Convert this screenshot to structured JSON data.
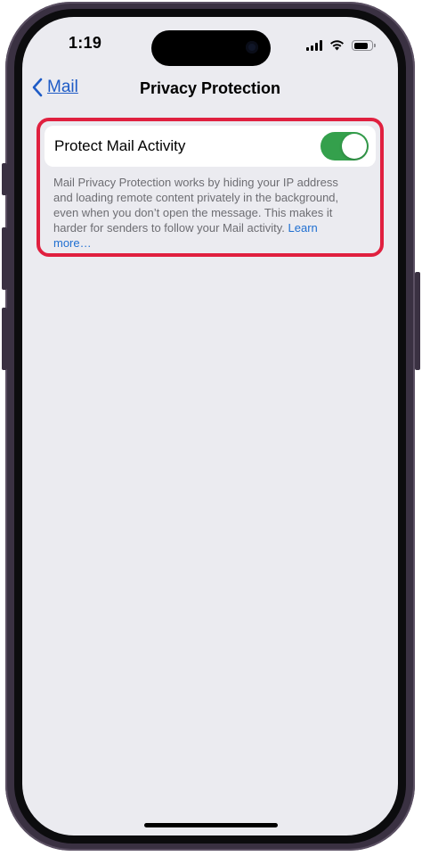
{
  "status_bar": {
    "time": "1:19",
    "signal_icon": "signal-bars-icon",
    "wifi_icon": "wifi-icon",
    "battery_icon": "battery-icon",
    "battery_level": 0.85
  },
  "nav": {
    "back_label": "Mail",
    "back_icon": "chevron-left-icon",
    "title": "Privacy Protection"
  },
  "setting": {
    "label": "Protect Mail Activity",
    "toggle_on": true,
    "description": "Mail Privacy Protection works by hiding your IP address and loading remote content privately in the background, even when you don’t open the message. This makes it harder for senders to follow your Mail activity.",
    "learn_more": "Learn more…"
  },
  "colors": {
    "highlight": "#e0203f",
    "toggle_on": "#34a04c",
    "link": "#1f6fd1",
    "background": "#ebebf0"
  }
}
